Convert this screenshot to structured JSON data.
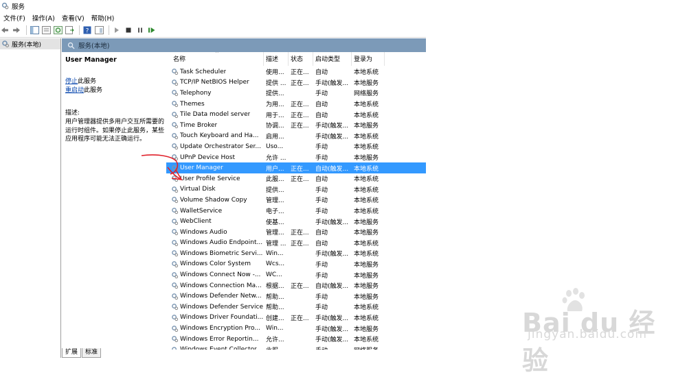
{
  "window": {
    "title": "服务"
  },
  "menu": [
    "文件(F)",
    "操作(A)",
    "查看(V)",
    "帮助(H)"
  ],
  "tree": {
    "item": "服务(本地)"
  },
  "main": {
    "header": "服务(本地)"
  },
  "details": {
    "service_name": "User Manager",
    "stop_link": "停止",
    "stop_suffix": "此服务",
    "restart_link": "重启动",
    "restart_suffix": "此服务",
    "description_label": "描述:",
    "description": "用户管理器提供多用户交互所需要的运行时组件。如果停止此服务，某些应用程序可能无法正确运行。"
  },
  "columns": [
    "名称",
    "描述",
    "状态",
    "启动类型",
    "登录为"
  ],
  "services": [
    {
      "name": "Task Scheduler",
      "desc": "使用...",
      "status": "正在...",
      "startup": "自动",
      "logon": "本地系统"
    },
    {
      "name": "TCP/IP NetBIOS Helper",
      "desc": "提供 ...",
      "status": "正在...",
      "startup": "手动(触发...",
      "logon": "本地服务"
    },
    {
      "name": "Telephony",
      "desc": "提供...",
      "status": "",
      "startup": "手动",
      "logon": "网络服务"
    },
    {
      "name": "Themes",
      "desc": "为用...",
      "status": "正在...",
      "startup": "自动",
      "logon": "本地系统"
    },
    {
      "name": "Tile Data model server",
      "desc": "用于...",
      "status": "正在...",
      "startup": "自动",
      "logon": "本地系统"
    },
    {
      "name": "Time Broker",
      "desc": "协调...",
      "status": "正在...",
      "startup": "手动(触发...",
      "logon": "本地服务"
    },
    {
      "name": "Touch Keyboard and Ha...",
      "desc": "启用...",
      "status": "",
      "startup": "手动(触发...",
      "logon": "本地系统"
    },
    {
      "name": "Update Orchestrator Ser...",
      "desc": "Uso...",
      "status": "",
      "startup": "手动",
      "logon": "本地系统"
    },
    {
      "name": "UPnP Device Host",
      "desc": "允许 ...",
      "status": "",
      "startup": "手动",
      "logon": "本地服务"
    },
    {
      "name": "User Manager",
      "desc": "用户...",
      "status": "正在...",
      "startup": "自动(触发...",
      "logon": "本地系统",
      "selected": true
    },
    {
      "name": "User Profile Service",
      "desc": "此服...",
      "status": "正在...",
      "startup": "自动",
      "logon": "本地系统"
    },
    {
      "name": "Virtual Disk",
      "desc": "提供...",
      "status": "",
      "startup": "手动",
      "logon": "本地系统"
    },
    {
      "name": "Volume Shadow Copy",
      "desc": "管理...",
      "status": "",
      "startup": "手动",
      "logon": "本地系统"
    },
    {
      "name": "WalletService",
      "desc": "电子...",
      "status": "",
      "startup": "手动",
      "logon": "本地系统"
    },
    {
      "name": "WebClient",
      "desc": "使基...",
      "status": "",
      "startup": "手动(触发...",
      "logon": "本地服务"
    },
    {
      "name": "Windows Audio",
      "desc": "管理...",
      "status": "正在...",
      "startup": "自动",
      "logon": "本地服务"
    },
    {
      "name": "Windows Audio Endpoint...",
      "desc": "管理 ...",
      "status": "正在...",
      "startup": "自动",
      "logon": "本地系统"
    },
    {
      "name": "Windows Biometric Servi...",
      "desc": "Win...",
      "status": "",
      "startup": "手动(触发...",
      "logon": "本地系统"
    },
    {
      "name": "Windows Color System",
      "desc": "Wcs...",
      "status": "",
      "startup": "手动",
      "logon": "本地服务"
    },
    {
      "name": "Windows Connect Now -...",
      "desc": "WC...",
      "status": "",
      "startup": "手动",
      "logon": "本地服务"
    },
    {
      "name": "Windows Connection Ma...",
      "desc": "根据...",
      "status": "正在...",
      "startup": "自动(触发...",
      "logon": "本地服务"
    },
    {
      "name": "Windows Defender Netw...",
      "desc": "帮助...",
      "status": "",
      "startup": "手动",
      "logon": "本地服务"
    },
    {
      "name": "Windows Defender Service",
      "desc": "帮助...",
      "status": "",
      "startup": "手动",
      "logon": "本地系统"
    },
    {
      "name": "Windows Driver Foundati...",
      "desc": "创建...",
      "status": "正在...",
      "startup": "手动(触发...",
      "logon": "本地系统"
    },
    {
      "name": "Windows Encryption Pro...",
      "desc": "Win...",
      "status": "",
      "startup": "手动(触发...",
      "logon": "本地服务"
    },
    {
      "name": "Windows Error Reportin...",
      "desc": "允许...",
      "status": "",
      "startup": "手动(触发...",
      "logon": "本地系统"
    },
    {
      "name": "Windows Event Collector",
      "desc": "此服...",
      "status": "",
      "startup": "手动",
      "logon": "网络服务"
    }
  ],
  "tabs": [
    "扩展",
    "标准"
  ],
  "watermark": {
    "logo": "Bai du 经验",
    "url": "jingyan.baidu.com"
  },
  "colors": {
    "header": "#7c9ab8",
    "selected": "#3399ff",
    "link": "#0645ad",
    "annotation": "#e0202a"
  }
}
